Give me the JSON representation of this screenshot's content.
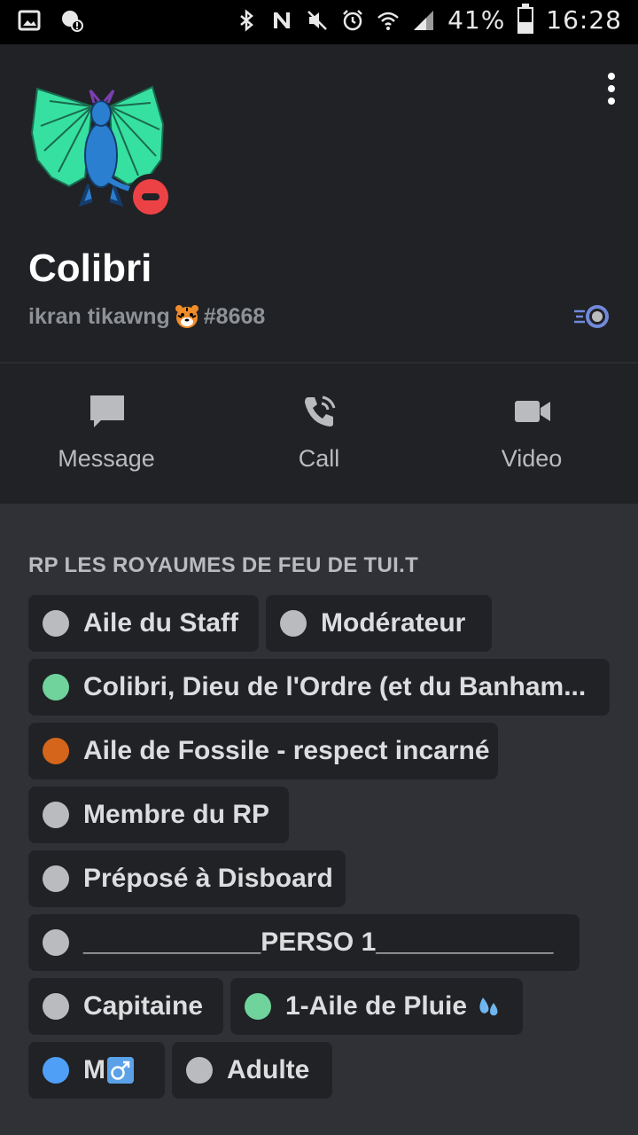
{
  "status_bar": {
    "battery_text": "41%",
    "time": "16:28",
    "battery_level": 0.41,
    "icons": [
      "gallery-icon",
      "blocked-icon",
      "bluetooth-icon",
      "nfc-icon",
      "mute-icon",
      "alarm-icon",
      "wifi-icon",
      "signal-icon",
      "battery-icon"
    ]
  },
  "profile": {
    "username": "Colibri",
    "subtitle": "ikran tikawng",
    "discriminator": "#8668",
    "status": "dnd",
    "status_color": "#ed4245"
  },
  "actions": [
    {
      "label": "Message",
      "icon": "message-icon"
    },
    {
      "label": "Call",
      "icon": "call-icon"
    },
    {
      "label": "Video",
      "icon": "video-icon"
    }
  ],
  "roles_section": {
    "title": "RP LES ROYAUMES DE FEU DE TUI.T",
    "roles": [
      {
        "name": "Aile du Staff",
        "color": "#b9bbbe"
      },
      {
        "name": "Modérateur",
        "color": "#b9bbbe"
      },
      {
        "name": "Colibri, Dieu de l'Ordre (et du Banham...",
        "color": "#6fd39b"
      },
      {
        "name": "Aile de Fossile - respect incarné",
        "color": "#d4651b"
      },
      {
        "name": "Membre du RP",
        "color": "#b9bbbe"
      },
      {
        "name": "Préposé à Disboard",
        "color": "#b9bbbe"
      },
      {
        "name": "____________PERSO 1____________",
        "color": "#b9bbbe"
      },
      {
        "name": "Capitaine",
        "color": "#b9bbbe"
      },
      {
        "name": "1-Aile de Pluie",
        "color": "#6fd39b"
      },
      {
        "name": "M",
        "color": "#4f9ff7"
      },
      {
        "name": "Adulte",
        "color": "#b9bbbe"
      }
    ]
  },
  "colors": {
    "header_bg": "#202225",
    "page_bg": "#2f3136",
    "chip_bg": "#202225",
    "muted_text": "#8e9297"
  }
}
